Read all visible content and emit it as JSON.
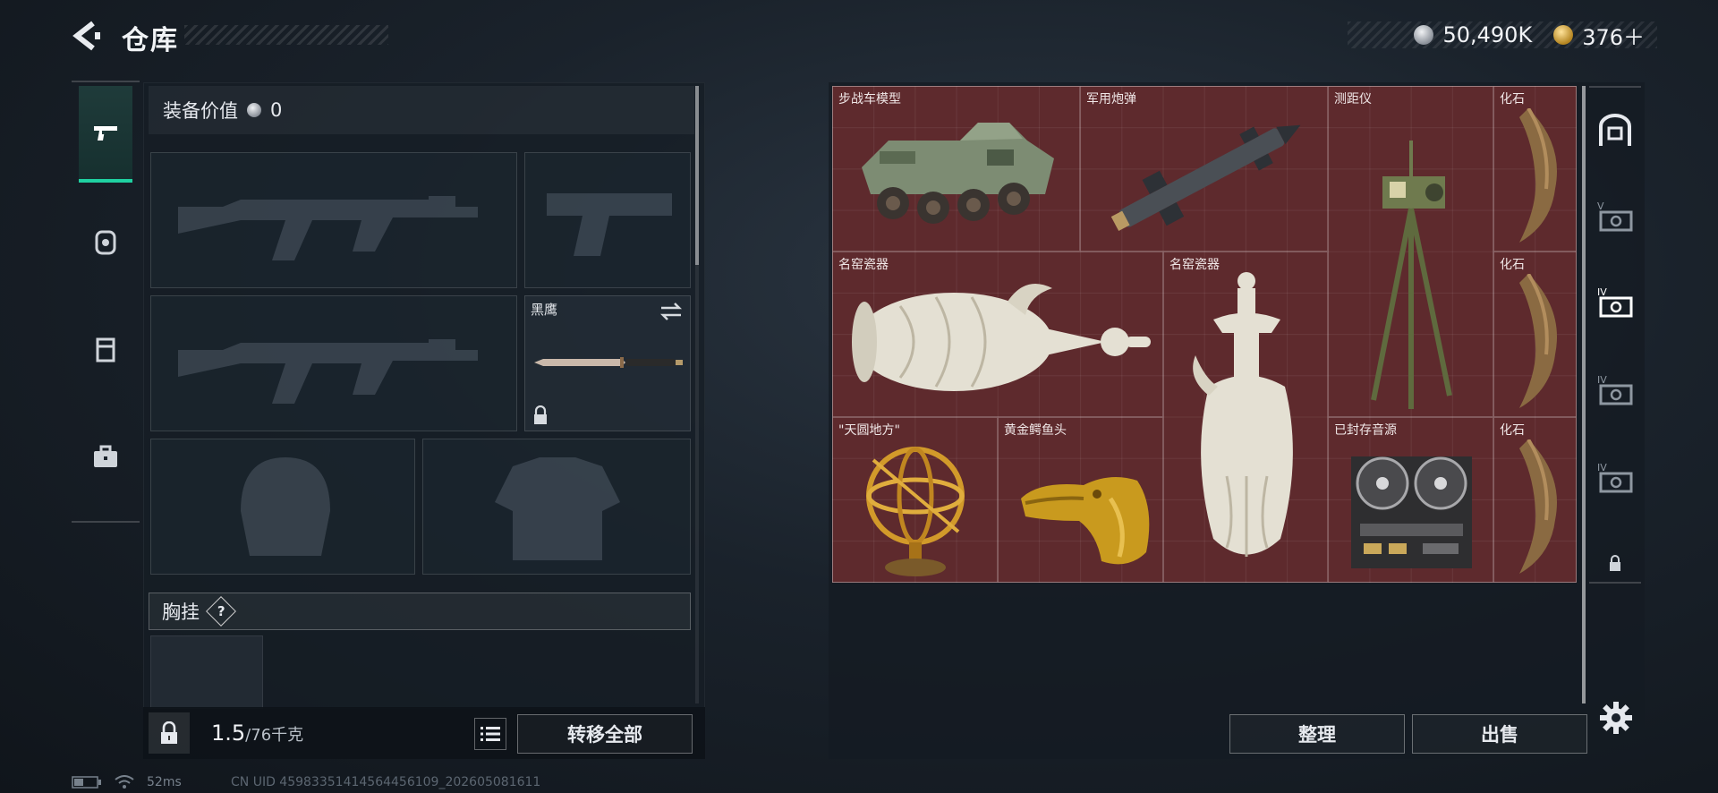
{
  "header": {
    "title": "仓库",
    "currency": [
      {
        "type": "silver",
        "amount": "50,490K"
      },
      {
        "type": "gold",
        "amount": "376＋"
      }
    ]
  },
  "rail": {
    "items": [
      {
        "name": "weapons",
        "icon": "pistol-icon",
        "active": true
      },
      {
        "name": "armor",
        "icon": "backpack-icon",
        "active": false
      },
      {
        "name": "vest",
        "icon": "vest-icon",
        "active": false
      },
      {
        "name": "case",
        "icon": "briefcase-icon",
        "active": false
      }
    ]
  },
  "equipment": {
    "value_label": "装备价值",
    "value": "0",
    "melee_label": "黑鹰",
    "rig_label": "胸挂",
    "help": "?",
    "weight_value": "1.5",
    "weight_capacity": "/76千克",
    "transfer_all": "转移全部"
  },
  "storage": {
    "items": [
      {
        "label": "步战车模型",
        "art": "ifv-model"
      },
      {
        "label": "军用炮弹",
        "art": "military-shell"
      },
      {
        "label": "测距仪",
        "art": "rangefinder"
      },
      {
        "label": "化石",
        "art": "fossil-claw"
      },
      {
        "label": "名窑瓷器",
        "art": "porcelain-ewer-lying"
      },
      {
        "label": "名窑瓷器",
        "art": "porcelain-ewer-standing"
      },
      {
        "label": "化石",
        "art": "fossil-claw"
      },
      {
        "label": "\"天圆地方\"",
        "art": "armillary-sphere"
      },
      {
        "label": "黄金鳄鱼头",
        "art": "golden-crocodile-head"
      },
      {
        "label": "已封存音源",
        "art": "reel-to-reel-recorder"
      },
      {
        "label": "化石",
        "art": "fossil-claw"
      }
    ],
    "sort": "整理",
    "sell": "出售",
    "tabs": [
      {
        "icon": "safe-box-icon",
        "tier": ""
      },
      {
        "icon": "case-tier-icon",
        "tier": "V"
      },
      {
        "icon": "case-tier-icon",
        "tier": "IV"
      },
      {
        "icon": "case-tier-icon",
        "tier": "IV"
      },
      {
        "icon": "case-tier-icon",
        "tier": "IV"
      },
      {
        "icon": "lock-icon",
        "tier": ""
      }
    ]
  },
  "status_bar": {
    "ping": "52ms",
    "uid": "CN UID 45983351414564456109_202605081611"
  },
  "colors": {
    "accent": "#1fd1a1",
    "storage_bg": "#5e2a2d",
    "panel_bg": "#161d25"
  }
}
